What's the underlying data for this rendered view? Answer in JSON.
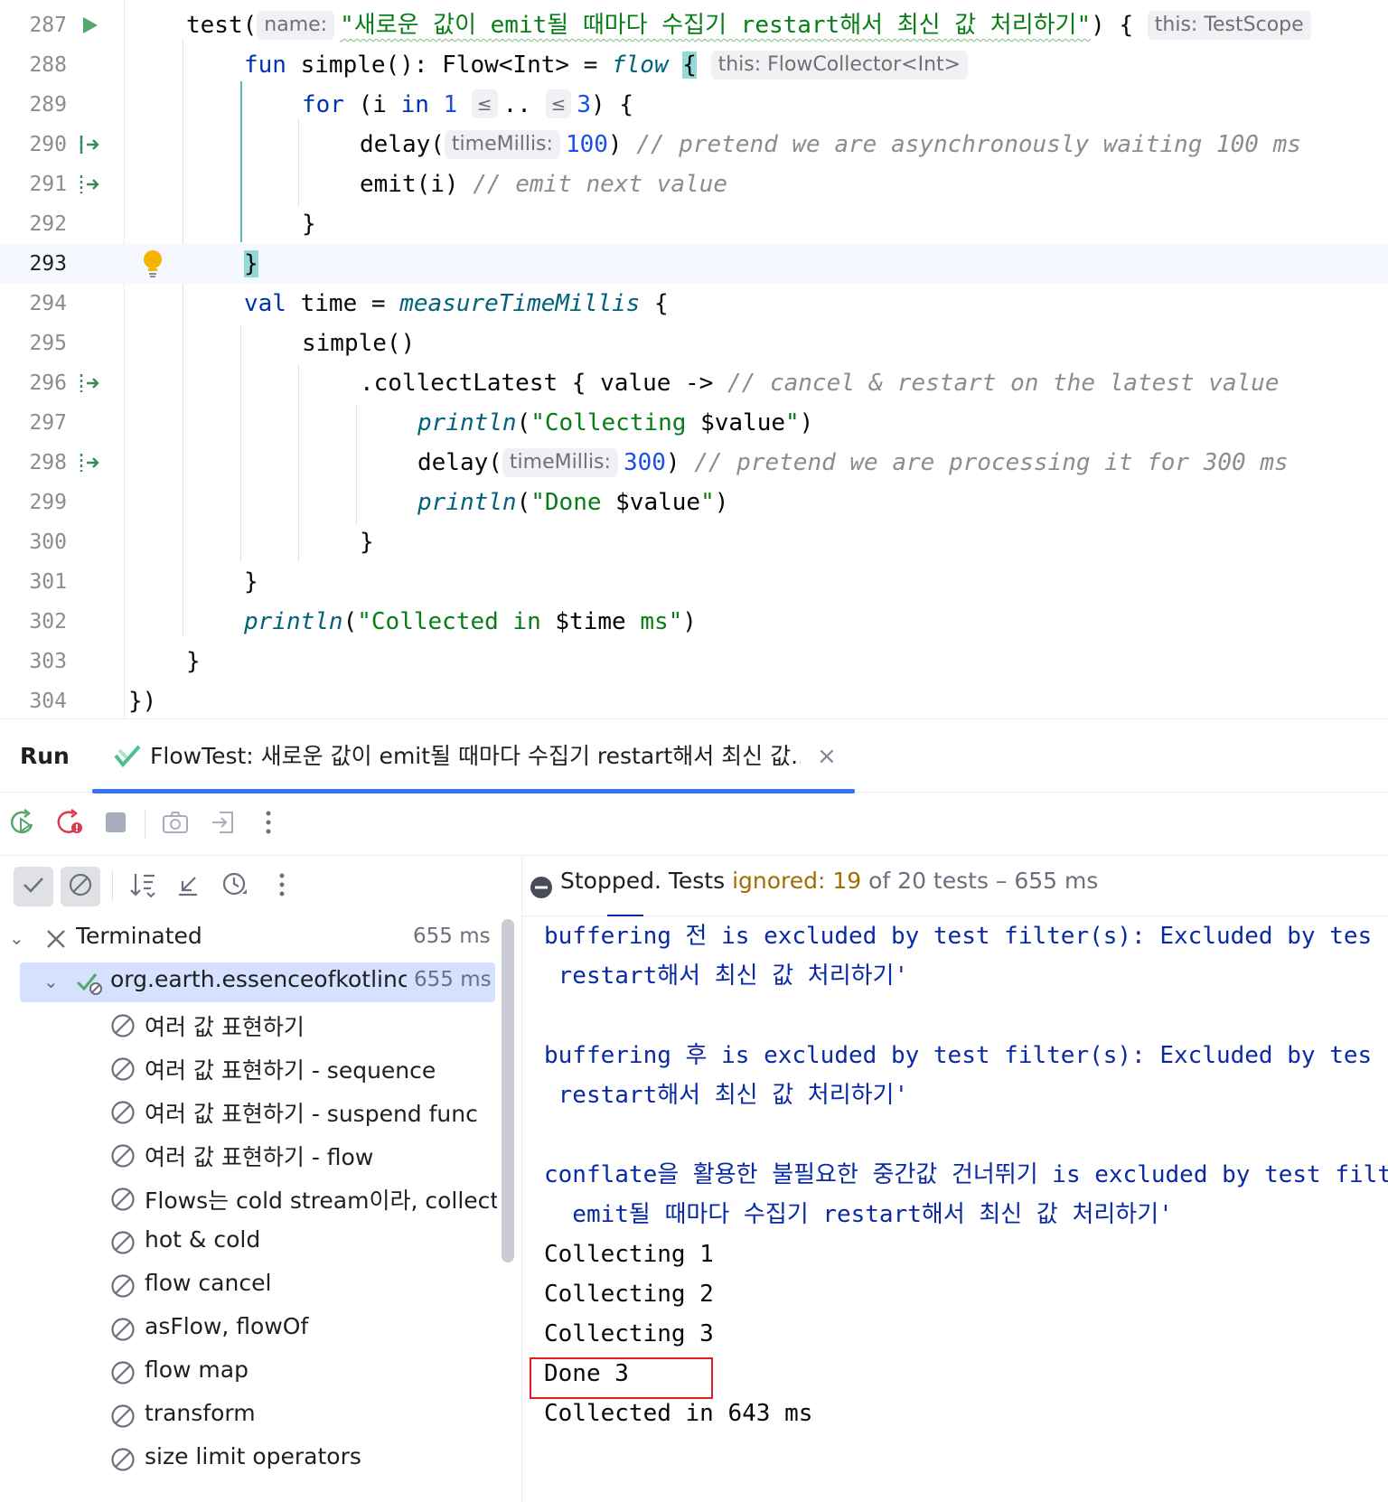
{
  "editor": {
    "lines": {
      "287": "287",
      "288": "288",
      "289": "289",
      "290": "290",
      "291": "291",
      "292": "292",
      "293": "293",
      "294": "294",
      "295": "295",
      "296": "296",
      "297": "297",
      "298": "298",
      "299": "299",
      "300": "300",
      "301": "301",
      "302": "302",
      "303": "303",
      "304": "304"
    },
    "hints": {
      "name": "name:",
      "this_testscope": "this: TestScope",
      "this_flowcollector": "this: FlowCollector<Int>",
      "le1": "≤",
      "le2": "≤",
      "timemillis1": "timeMillis:",
      "timemillis2": "timeMillis:"
    },
    "text": {
      "test_call": "test(",
      "test_name": "\"새로운 값이 emit될 때마다 수집기 restart해서 최신 값 처리하기\"",
      "test_tail": ") {",
      "fun_kw": "fun",
      "simple_sig": " simple(): Flow<Int> = ",
      "flow_fn": "flow",
      "open_brace": "{",
      "for_kw": "for",
      "for_paren": " (i ",
      "in_kw": "in",
      "range_start": " 1",
      "range_dots": "..",
      "range_end": "3",
      "for_tail": ") {",
      "delay1": "delay(",
      "delay1_val": "100",
      "delay1_tail": ") ",
      "delay1_cmt": "// pretend we are asynchronously waiting 100 ms",
      "emit": "emit(i) ",
      "emit_cmt": "// emit next value",
      "close1": "}",
      "close2": "}",
      "val_kw": "val",
      "time_decl": " time = ",
      "measure_fn": "measureTimeMillis",
      "measure_tail": " {",
      "simple_call": "simple()",
      "collect_latest": ".collectLatest { value -> ",
      "collect_cmt": "// cancel & restart on the latest value",
      "println1_fn": "println",
      "println1_a": "(",
      "println1_s1": "\"Collecting ",
      "println1_t": "$value",
      "println1_s2": "\"",
      "println1_b": ")",
      "delay2": "delay(",
      "delay2_val": "300",
      "delay2_tail": ") ",
      "delay2_cmt": "// pretend we are processing it for 300 ms",
      "println2_fn": "println",
      "println2_a": "(",
      "println2_s1": "\"Done ",
      "println2_t": "$value",
      "println2_s2": "\"",
      "println2_b": ")",
      "close3": "}",
      "close4": "}",
      "println3_fn": "println",
      "println3_a": "(",
      "println3_s1": "\"Collected in ",
      "println3_t": "$time",
      "println3_s2": " ms\"",
      "println3_b": ")",
      "close5": "}",
      "close6": "})"
    }
  },
  "run": {
    "title": "Run",
    "tab_label": "FlowTest: 새로운 값이 emit될 때마다 수집기 restart해서 최신 값...",
    "tab_close": "×"
  },
  "tree": {
    "root": {
      "label": "Terminated",
      "time": "655 ms"
    },
    "suite": {
      "label": "org.earth.essenceofkotlinc",
      "time": "655 ms"
    },
    "items": [
      "여러 값 표현하기",
      "여러 값 표현하기 - sequence",
      "여러 값 표현하기 - suspend func",
      "여러 값 표현하기 - flow",
      "Flows는 cold stream이라, collect",
      "hot & cold",
      "flow cancel",
      "asFlow, flowOf",
      "flow map",
      "transform",
      "size limit operators"
    ]
  },
  "console": {
    "status": {
      "prefix": "Stopped. Tests ",
      "ignored": "ignored: 19",
      "suffix": " of 20 tests – 655 ms"
    },
    "lines": [
      "buffering 전 is excluded by test filter(s): Excluded by tes",
      " restart해서 최신 값 처리하기'",
      "buffering 후 is excluded by test filter(s): Excluded by tes",
      " restart해서 최신 값 처리하기'",
      "conflate을 활용한 불필요한 중간값 건너뛰기 is excluded by test filte",
      "  emit될 때마다 수집기 restart해서 최신 값 처리하기'",
      "Collecting 1",
      "Collecting 2",
      "Collecting 3",
      "Done 3",
      "Collected in 643 ms"
    ]
  },
  "colors": {
    "accent": "#3574f0",
    "keyword": "#0033b3",
    "string": "#067d17",
    "number": "#1750eb",
    "comment": "#8c8c8c",
    "system_output": "#0a2aa4",
    "ignored": "#a36d00",
    "highlight_box": "#e02020"
  },
  "icons": {
    "run_gutter": "run-triangle-icon",
    "suspend_call": "suspend-call-icon",
    "intention": "lightbulb-icon",
    "tab": "test-tab-icon",
    "rerun": "rerun-icon",
    "rerun_failed": "rerun-failed-icon",
    "stop": "stop-icon",
    "screenshot": "camera-icon",
    "export": "export-icon",
    "more": "more-icon",
    "show_passed": "check-icon",
    "show_ignored": "ignored-icon",
    "sort": "sort-icon",
    "collapse": "collapse-icon",
    "history": "history-icon",
    "terminated": "close-x-icon",
    "passed": "passed-icon",
    "ignored": "ignored-icon",
    "status_stopped": "stopped-icon"
  }
}
